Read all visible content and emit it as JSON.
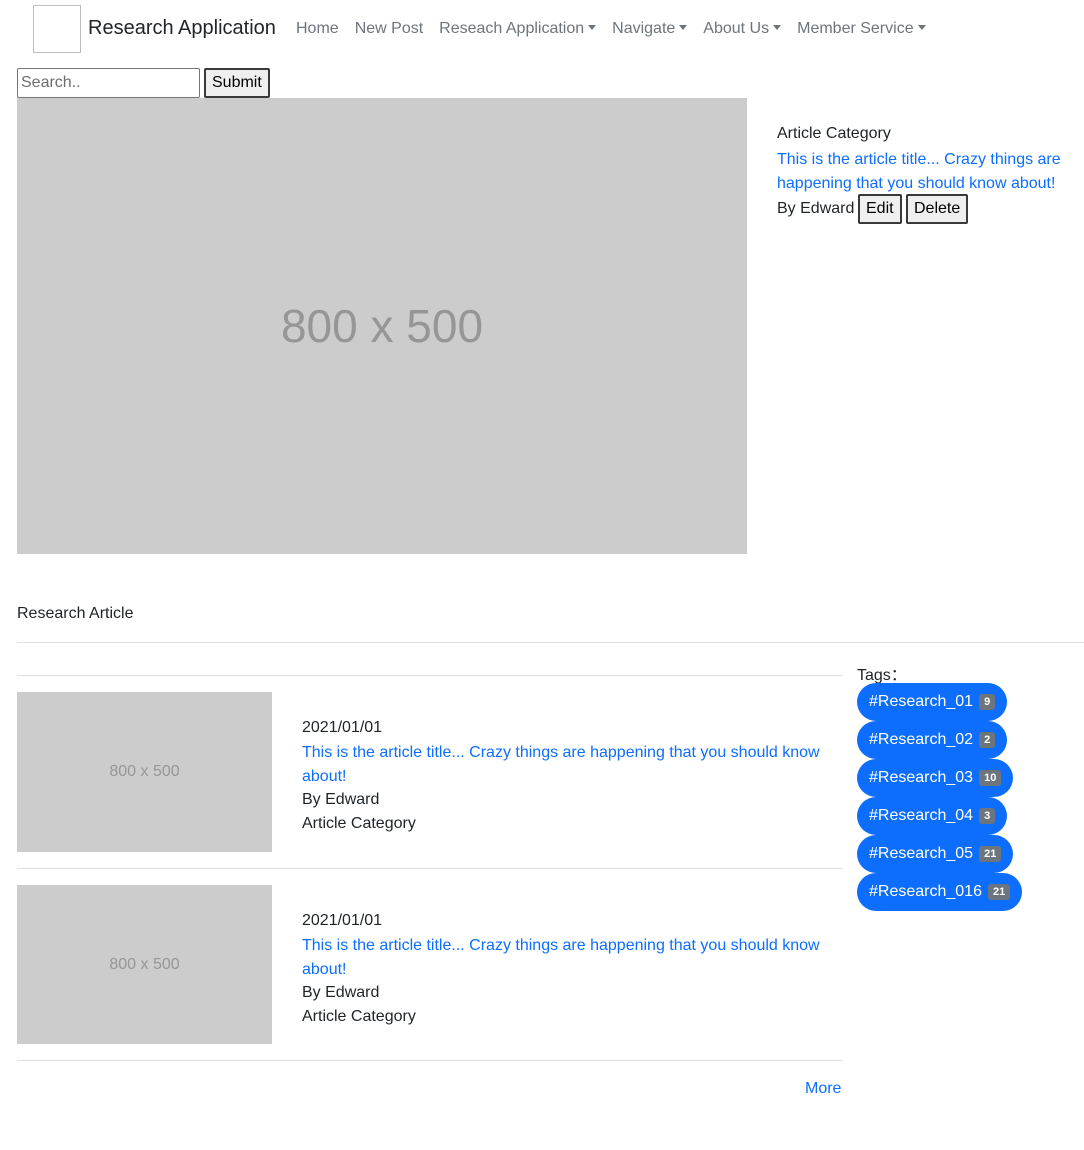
{
  "nav": {
    "brand": "Research Application",
    "items": [
      {
        "label": "Home",
        "dropdown": false
      },
      {
        "label": "New Post",
        "dropdown": false
      },
      {
        "label": "Reseach Application",
        "dropdown": true
      },
      {
        "label": "Navigate",
        "dropdown": true
      },
      {
        "label": "About Us",
        "dropdown": true
      },
      {
        "label": "Member Service",
        "dropdown": true
      }
    ]
  },
  "search": {
    "placeholder": "Search..",
    "value": "",
    "submit_label": "Submit"
  },
  "featured": {
    "image_label": "800 x 500",
    "category": "Article Category",
    "title": "This is the article title... Crazy things are happening that you should know about!",
    "author": "By Edward",
    "edit_label": "Edit",
    "delete_label": "Delete"
  },
  "section_heading": "Research Article",
  "articles": [
    {
      "image_label": "800 x 500",
      "date": "2021/01/01",
      "title": "This is the article title... Crazy things are happening that you should know about!",
      "author": "By Edward",
      "category": "Article Category"
    },
    {
      "image_label": "800 x 500",
      "date": "2021/01/01",
      "title": "This is the article title... Crazy things are happening that you should know about!",
      "author": "By Edward",
      "category": "Article Category"
    }
  ],
  "tags": {
    "label": "Tags：",
    "items": [
      {
        "name": "#Research_01",
        "count": "9"
      },
      {
        "name": "#Research_02",
        "count": "2"
      },
      {
        "name": "#Research_03",
        "count": "10"
      },
      {
        "name": "#Research_04",
        "count": "3"
      },
      {
        "name": "#Research_05",
        "count": "21"
      },
      {
        "name": "#Research_016",
        "count": "21"
      }
    ]
  },
  "more_label": "More",
  "colors": {
    "link": "#0d6efd",
    "tag_bg": "#0d6efd",
    "badge_bg": "#6c757d",
    "placeholder_bg": "#cccccc"
  }
}
